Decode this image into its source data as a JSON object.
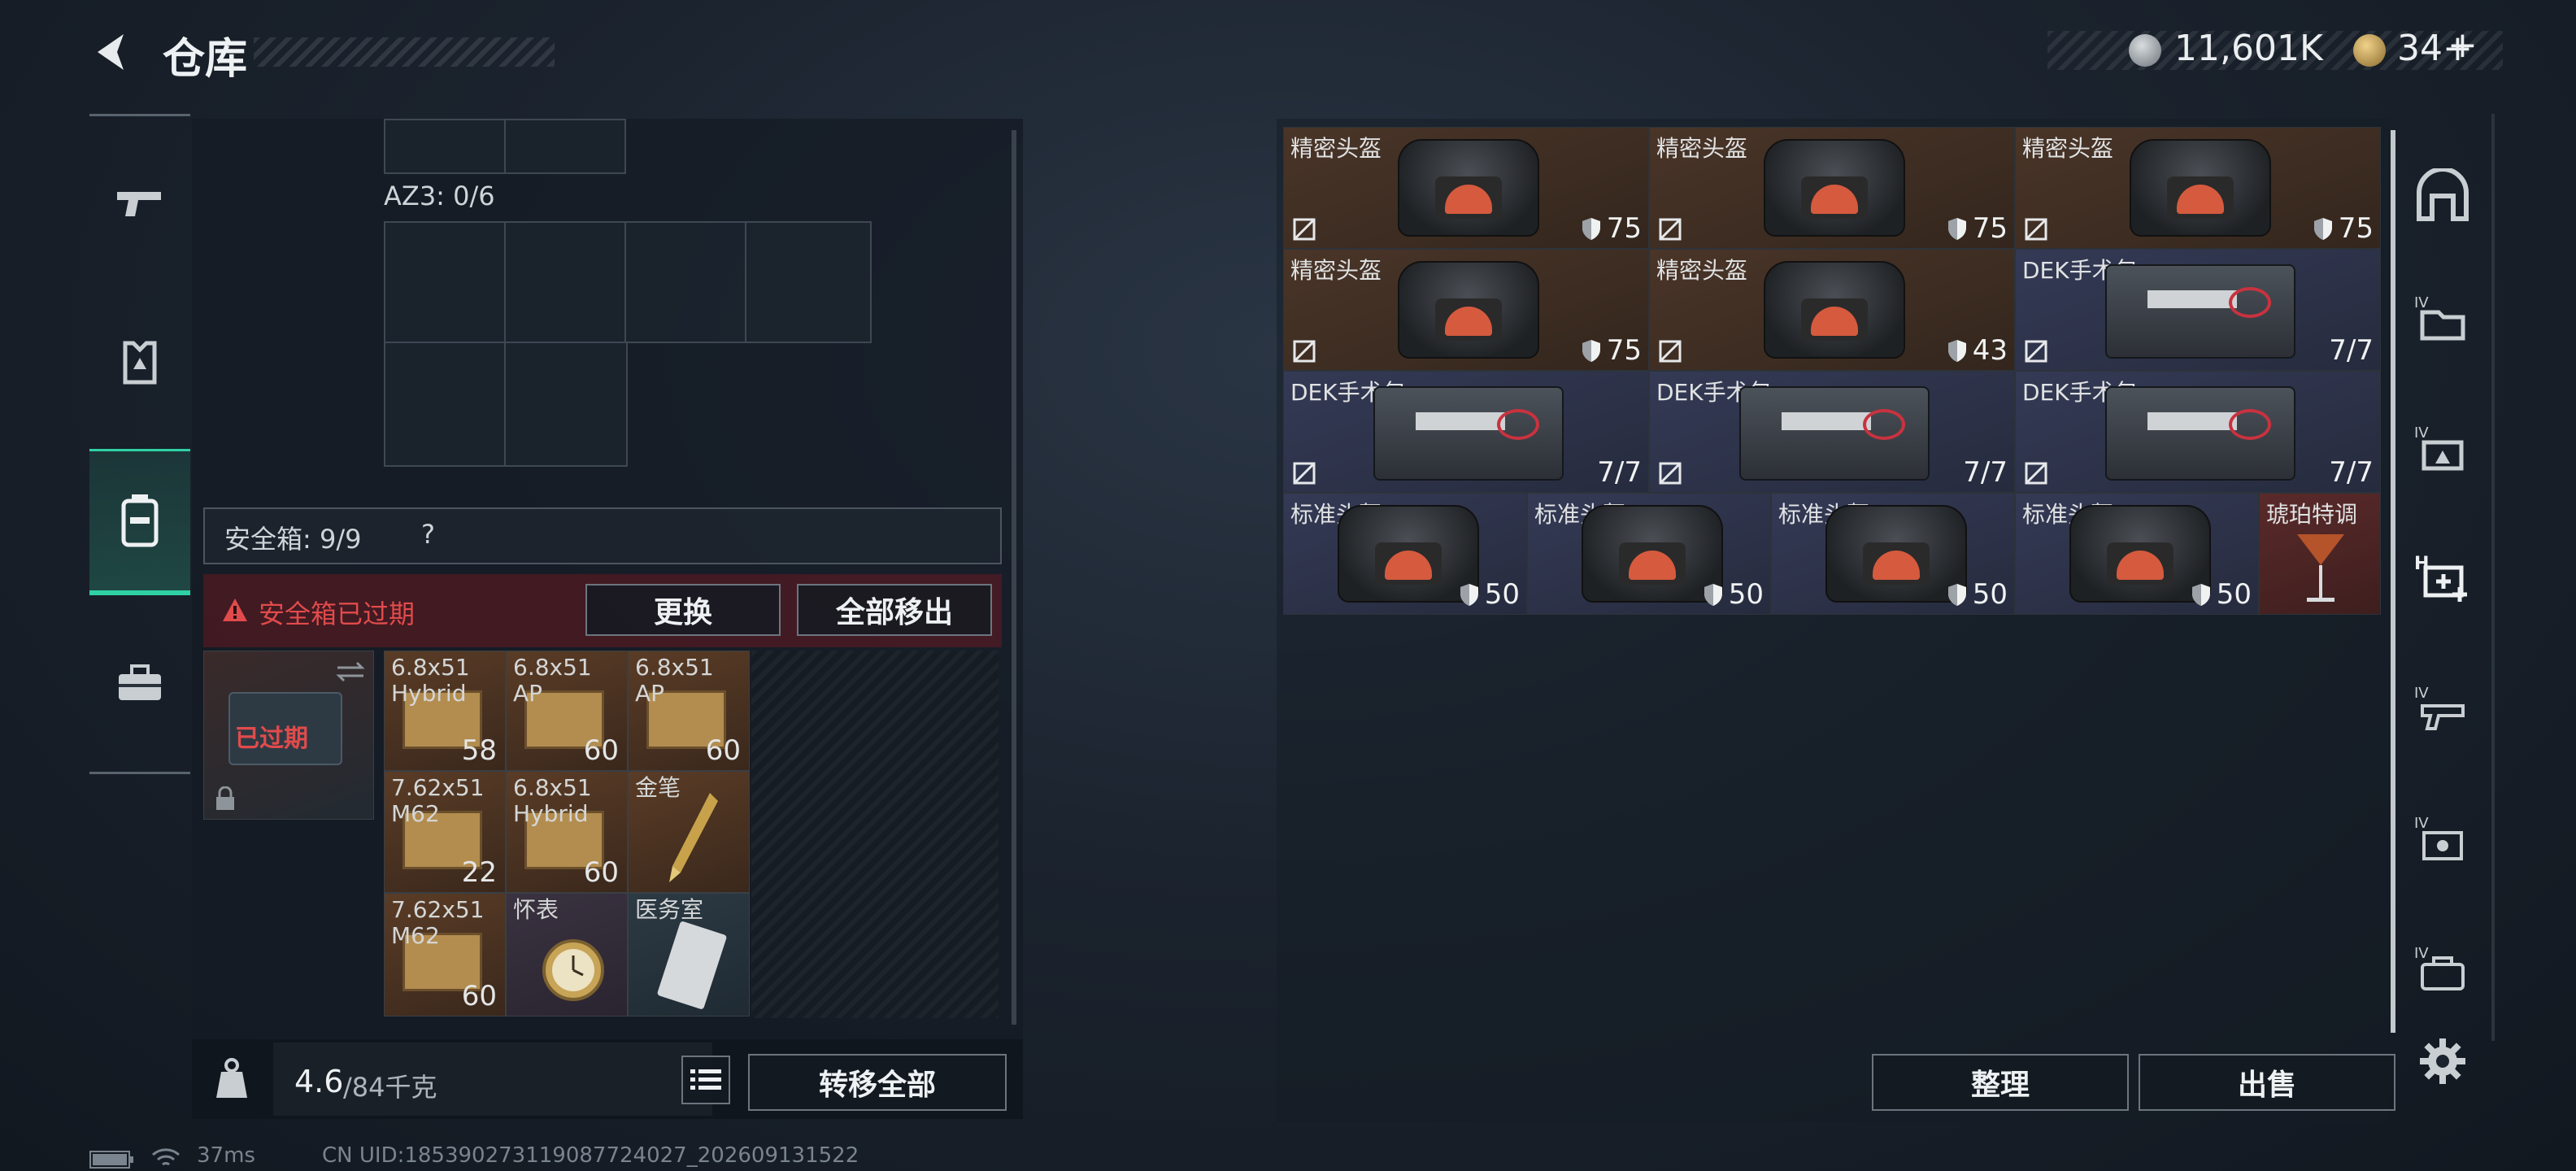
{
  "header": {
    "title": "仓库",
    "silver": "11,601K",
    "gold": "34+",
    "add": "+"
  },
  "left_rail": [
    {
      "id": "weapons",
      "icon": "gun-icon"
    },
    {
      "id": "armor",
      "icon": "armor-icon"
    },
    {
      "id": "backpack",
      "icon": "backpack-icon",
      "active": true
    },
    {
      "id": "case",
      "icon": "briefcase-icon"
    }
  ],
  "left_panel": {
    "slot_label": "AZ3: 0/6",
    "safebox_label": "安全箱: 9/9",
    "help": "?",
    "expired_msg": "安全箱已过期",
    "replace_btn": "更换",
    "remove_all_btn": "全部移出",
    "box_expired": "已过期",
    "items": [
      {
        "name": "6.8x51 Hybrid",
        "count": "58"
      },
      {
        "name": "6.8x51 AP",
        "count": "60"
      },
      {
        "name": "6.8x51 AP",
        "count": "60"
      },
      {
        "name": "7.62x51 M62",
        "count": "22"
      },
      {
        "name": "6.8x51 Hybrid",
        "count": "60"
      },
      {
        "name": "金笔",
        "count": ""
      },
      {
        "name": "7.62x51 M62",
        "count": "60"
      },
      {
        "name": "怀表",
        "count": ""
      },
      {
        "name": "医务室",
        "count": ""
      }
    ],
    "weight": "4.6",
    "weight_total": "/84千克",
    "transfer_all": "转移全部"
  },
  "right_panel": {
    "rows": [
      [
        {
          "name": "精密头盔",
          "val": "75",
          "bg": "brown",
          "kind": "helmet"
        },
        {
          "name": "精密头盔",
          "val": "75",
          "bg": "brown",
          "kind": "helmet"
        },
        {
          "name": "精密头盔",
          "val": "75",
          "bg": "brown",
          "kind": "helmet"
        }
      ],
      [
        {
          "name": "精密头盔",
          "val": "75",
          "bg": "brown",
          "kind": "helmet"
        },
        {
          "name": "精密头盔",
          "val": "43",
          "bg": "brown",
          "kind": "helmet"
        },
        {
          "name": "DEK手术包",
          "val": "7/7",
          "bg": "navy",
          "kind": "kit"
        }
      ],
      [
        {
          "name": "DEK手术包",
          "val": "7/7",
          "bg": "navy",
          "kind": "kit"
        },
        {
          "name": "DEK手术包",
          "val": "7/7",
          "bg": "navy",
          "kind": "kit"
        },
        {
          "name": "DEK手术包",
          "val": "7/7",
          "bg": "navy",
          "kind": "kit"
        }
      ]
    ],
    "row4": [
      {
        "name": "标准头盔",
        "val": "50"
      },
      {
        "name": "标准头盔",
        "val": "50"
      },
      {
        "name": "标准头盔",
        "val": "50"
      },
      {
        "name": "标准头盔",
        "val": "50"
      },
      {
        "name": "琥珀特调",
        "val": ""
      }
    ],
    "sort_btn": "整理",
    "sell_btn": "出售"
  },
  "right_tools": [
    "vault-icon",
    "folder-4-icon",
    "storage-4-icon",
    "medical-plus-icon",
    "gun-4-icon",
    "armor-4-icon",
    "bag-4-icon",
    "settings-icon"
  ],
  "footer": {
    "ping": "37ms",
    "uid": "CN UID:185390273119087724027_202609131522"
  },
  "colors": {
    "accent": "#2fd1a4",
    "expired": "#e14b4b",
    "brown_cell": "#4a3528",
    "navy_cell": "#343a55"
  }
}
